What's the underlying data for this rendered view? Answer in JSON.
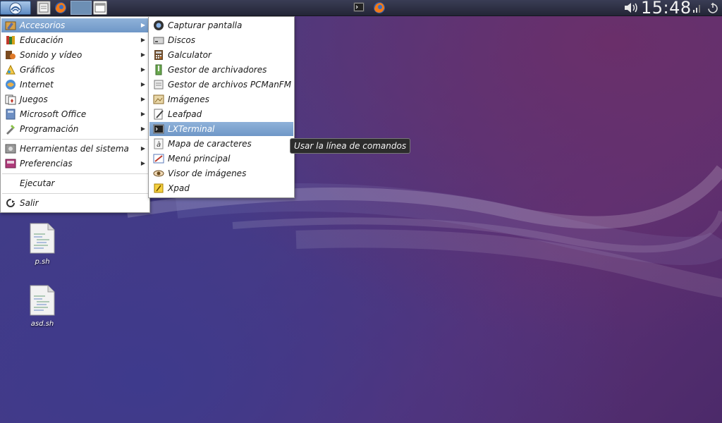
{
  "panel": {
    "clock": "15:48"
  },
  "main_menu": {
    "items": [
      {
        "label": "Accesorios",
        "icon": "accessories-icon",
        "has_submenu": true,
        "selected": true
      },
      {
        "label": "Educación",
        "icon": "education-icon",
        "has_submenu": true
      },
      {
        "label": "Sonido y vídeo",
        "icon": "multimedia-icon",
        "has_submenu": true
      },
      {
        "label": "Gráficos",
        "icon": "graphics-icon",
        "has_submenu": true
      },
      {
        "label": "Internet",
        "icon": "internet-icon",
        "has_submenu": true
      },
      {
        "label": "Juegos",
        "icon": "games-icon",
        "has_submenu": true
      },
      {
        "label": "Microsoft Office",
        "icon": "office-icon",
        "has_submenu": true
      },
      {
        "label": "Programación",
        "icon": "programming-icon",
        "has_submenu": true
      },
      {
        "label": "Herramientas del sistema",
        "icon": "system-tools-icon",
        "has_submenu": true
      },
      {
        "label": "Preferencias",
        "icon": "preferences-icon",
        "has_submenu": true
      },
      {
        "label": "Ejecutar",
        "icon": "",
        "has_submenu": false
      },
      {
        "label": "Salir",
        "icon": "logout-icon",
        "has_submenu": false
      }
    ]
  },
  "sub_menu": {
    "items": [
      {
        "label": "Capturar pantalla",
        "icon": "screenshot-icon"
      },
      {
        "label": "Discos",
        "icon": "disks-icon"
      },
      {
        "label": "Galculator",
        "icon": "calculator-icon"
      },
      {
        "label": "Gestor de archivadores",
        "icon": "archive-manager-icon"
      },
      {
        "label": "Gestor de archivos PCManFM",
        "icon": "file-manager-icon"
      },
      {
        "label": "Imágenes",
        "icon": "images-icon"
      },
      {
        "label": "Leafpad",
        "icon": "text-editor-icon"
      },
      {
        "label": "LXTerminal",
        "icon": "terminal-icon",
        "selected": true
      },
      {
        "label": "Mapa de caracteres",
        "icon": "character-map-icon"
      },
      {
        "label": "Menú principal",
        "icon": "menu-editor-icon"
      },
      {
        "label": "Visor de imágenes",
        "icon": "image-viewer-icon"
      },
      {
        "label": "Xpad",
        "icon": "notes-icon"
      }
    ]
  },
  "tooltip": {
    "text": "Usar la línea de comandos"
  },
  "desktop": {
    "icons": [
      {
        "label": "p.sh",
        "icon": "shell-script-icon"
      },
      {
        "label": "asd.sh",
        "icon": "shell-script-icon"
      }
    ]
  },
  "colors": {
    "selection": "#7aa0cc",
    "panel": "#2a2c3e",
    "tooltip_bg": "#2c2c2c"
  }
}
